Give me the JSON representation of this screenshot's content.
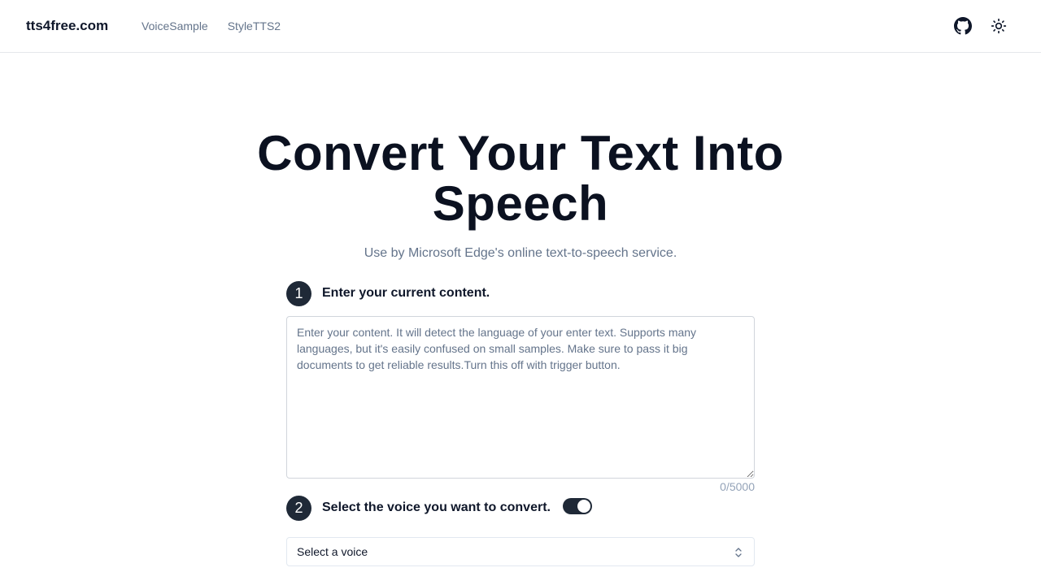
{
  "header": {
    "brand": "tts4free.com",
    "nav": [
      {
        "label": "VoiceSample"
      },
      {
        "label": "StyleTTS2"
      }
    ],
    "icons": [
      "github-icon",
      "sun-icon"
    ]
  },
  "hero": {
    "title_line1": "Convert Your Text Into",
    "title_line2": "Speech",
    "subtitle": "Use by Microsoft Edge's online text-to-speech service."
  },
  "step1": {
    "number": "1",
    "label": "Enter your current content.",
    "textarea_value": "",
    "textarea_placeholder": "Enter your content. It will detect the language of your enter text. Supports many languages, but it's easily confused on small samples. Make sure to pass it big documents to get reliable results.Turn this off with trigger button.",
    "char_count": "0/5000"
  },
  "step2": {
    "number": "2",
    "label": "Select the voice you want to convert.",
    "toggle_on": true,
    "select_value": "Select a voice"
  },
  "colors": {
    "badge_bg": "#1f2937",
    "toggle_bg": "#1f2937",
    "muted_text": "#64748b",
    "border": "#e5e7eb"
  }
}
